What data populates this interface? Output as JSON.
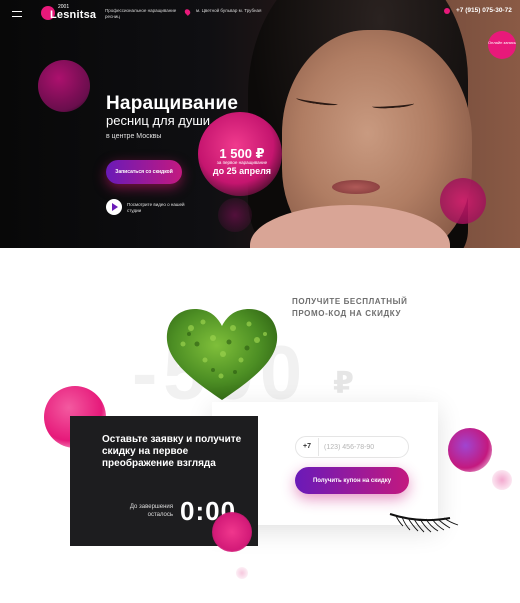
{
  "header": {
    "logo_small": "2001",
    "logo": "Lesnitsa",
    "tagline": "Профессиональное наращивание ресниц",
    "address": "м. Цветной бульвар м. Трубная",
    "phone": "+7 (915) 075-30-72",
    "callback": "Онлайн запись"
  },
  "hero": {
    "title": "Наращивание",
    "subtitle": "ресниц для души",
    "location": "в центре Москвы",
    "price": "1 500 ₽",
    "price_note": "за первое наращивание",
    "price_date": "до 25 апреля",
    "signup_button": "Записаться со скидкой",
    "video_text": "Посмотрите видео о нашей студии"
  },
  "promo": {
    "heading": "ПОЛУЧИТЕ БЕСПЛАТНЫЙ ПРОМО-КОД НА СКИДКУ",
    "big_price": "-500",
    "currency": "₽"
  },
  "form": {
    "title": "Оставьте заявку и получите скидку на первое преображение взгляда",
    "timer_label": "До завершения осталось",
    "timer": "0:00",
    "phone_prefix": "+7",
    "phone_placeholder": "(123) 456-78-90",
    "submit_button": "Получить купон на скидку"
  },
  "colors": {
    "accent": "#e8197a",
    "gradient_start": "#6a1ab8",
    "gradient_end": "#c3197f",
    "dark_card": "#1d1d1f"
  },
  "icons": [
    "menu-icon",
    "location-pin-icon",
    "phone-icon",
    "play-icon",
    "heart-leaf-image",
    "eyelash-image"
  ]
}
